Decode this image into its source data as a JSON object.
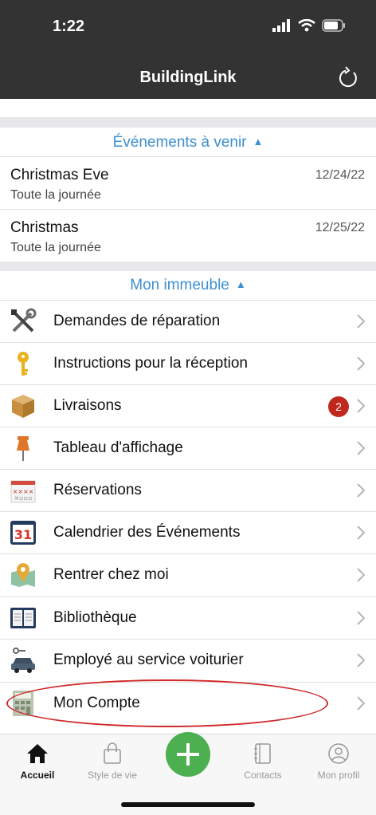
{
  "status_bar": {
    "time": "1:22"
  },
  "header": {
    "title": "BuildingLink"
  },
  "upcoming": {
    "title": "Événements à venir",
    "caret": "▲",
    "events": [
      {
        "title": "Christmas Eve",
        "subtitle": "Toute la journée",
        "date": "12/24/22"
      },
      {
        "title": "Christmas",
        "subtitle": "Toute la journée",
        "date": "12/25/22"
      }
    ]
  },
  "building": {
    "title": "Mon immeuble",
    "caret": "▲",
    "items": [
      {
        "label": "Demandes de réparation",
        "icon": "tools-icon"
      },
      {
        "label": "Instructions pour la réception",
        "icon": "key-icon"
      },
      {
        "label": "Livraisons",
        "icon": "package-icon",
        "badge": "2"
      },
      {
        "label": "Tableau d'affichage",
        "icon": "pushpin-icon"
      },
      {
        "label": "Réservations",
        "icon": "calendar-grid-icon"
      },
      {
        "label": "Calendrier des Événements",
        "icon": "calendar-31-icon",
        "icon_text": "31"
      },
      {
        "label": "Rentrer chez moi",
        "icon": "map-pin-icon"
      },
      {
        "label": "Bibliothèque",
        "icon": "book-icon"
      },
      {
        "label": "Employé au service voiturier",
        "icon": "car-key-icon"
      },
      {
        "label": "Mon Compte",
        "icon": "calculator-icon"
      }
    ]
  },
  "tabbar": {
    "tabs": [
      {
        "label": "Accueil",
        "icon": "home-icon",
        "active": true
      },
      {
        "label": "Style de vie",
        "icon": "shopping-bag-icon"
      },
      {
        "label": "",
        "icon": "plus-icon"
      },
      {
        "label": "Contacts",
        "icon": "address-book-icon"
      },
      {
        "label": "Mon profil",
        "icon": "profile-icon"
      }
    ]
  },
  "colors": {
    "header_bg": "#333333",
    "accent_blue": "#3d8fd0",
    "badge_red": "#c0281e",
    "fab_green": "#4caf50",
    "annotation_red": "#d12a2a"
  }
}
